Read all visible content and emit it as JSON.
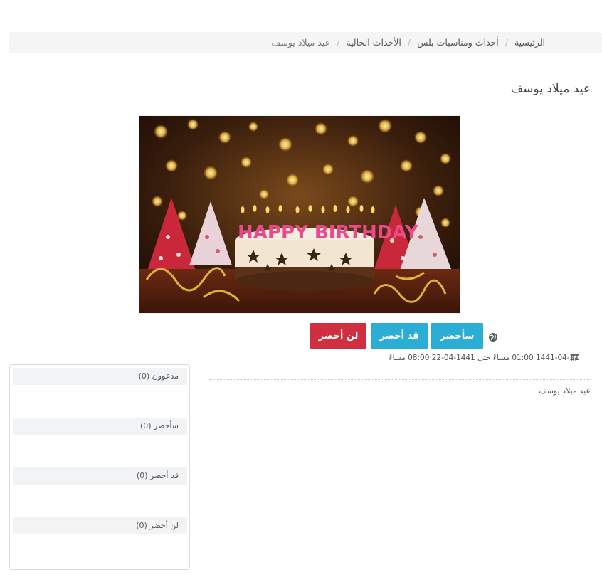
{
  "breadcrumb": {
    "items": [
      "الرئيسية",
      "أحداث ومناسبات بلس",
      "الأحداث الحالية"
    ],
    "current": "عيد ميلاد يوسف",
    "separator": "/"
  },
  "event": {
    "title": "عيد ميلاد يوسف",
    "datetime": "1441-04-21 01:00 مساءً حتى 1441-04-22 08:00 مساءً",
    "description": "عيد ميلاد يوسف",
    "image_text": "HAPPY BIRTHDAY"
  },
  "rsvp": {
    "attend": "سأحضر",
    "attended": "قد أحضر",
    "not_attend": "لن أحضر"
  },
  "attendees": {
    "invited": "مدعوون (0)",
    "attending": "سأحضر (0)",
    "maybe": "قد أحضر (0)",
    "not_attending": "لن أحضر (0)"
  },
  "colors": {
    "primary_button": "#2aaed6",
    "danger_button": "#d02f3f",
    "breadcrumb_bg": "#f5f5f5"
  },
  "icons": {
    "globe": "globe-icon",
    "calendar": "calendar-icon"
  }
}
